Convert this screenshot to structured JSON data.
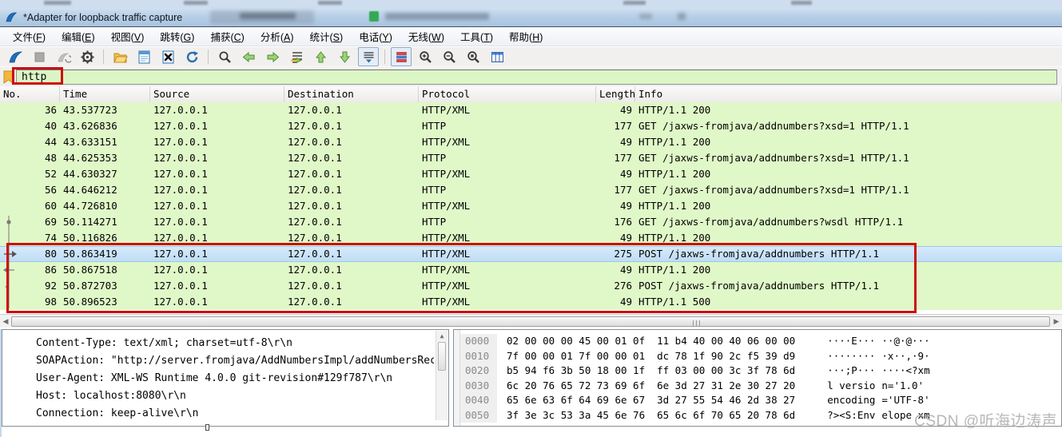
{
  "window": {
    "title": "*Adapter for loopback traffic capture"
  },
  "menu": {
    "items": [
      {
        "label": "文件",
        "accel": "F"
      },
      {
        "label": "编辑",
        "accel": "E"
      },
      {
        "label": "视图",
        "accel": "V"
      },
      {
        "label": "跳转",
        "accel": "G"
      },
      {
        "label": "捕获",
        "accel": "C"
      },
      {
        "label": "分析",
        "accel": "A"
      },
      {
        "label": "统计",
        "accel": "S"
      },
      {
        "label": "电话",
        "accel": "Y"
      },
      {
        "label": "无线",
        "accel": "W"
      },
      {
        "label": "工具",
        "accel": "T"
      },
      {
        "label": "帮助",
        "accel": "H"
      }
    ]
  },
  "toolbar": {
    "groups": [
      [
        "start-capture-icon",
        "stop-capture-icon",
        "restart-capture-icon",
        "capture-options-icon"
      ],
      [
        "open-file-icon",
        "save-file-icon",
        "close-file-icon",
        "reload-file-icon"
      ],
      [
        "find-packet-icon",
        "go-back-icon",
        "go-forward-icon",
        "go-to-packet-icon",
        "go-first-icon",
        "go-last-icon",
        "auto-scroll-icon"
      ],
      [
        "colorize-icon",
        "zoom-in-icon",
        "zoom-out-icon",
        "zoom-reset-icon",
        "resize-columns-icon"
      ]
    ],
    "toggled": [
      "auto-scroll-icon",
      "colorize-icon"
    ]
  },
  "filter": {
    "value": "http"
  },
  "packet_list": {
    "columns": [
      "No.",
      "Time",
      "Source",
      "Destination",
      "Protocol",
      "Length",
      "Info"
    ],
    "selected_no": "80",
    "rows": [
      {
        "no": "36",
        "time": "43.537723",
        "src": "127.0.0.1",
        "dst": "127.0.0.1",
        "proto": "HTTP/XML",
        "len": "49",
        "info": "HTTP/1.1 200"
      },
      {
        "no": "40",
        "time": "43.626836",
        "src": "127.0.0.1",
        "dst": "127.0.0.1",
        "proto": "HTTP",
        "len": "177",
        "info": "GET /jaxws-fromjava/addnumbers?xsd=1 HTTP/1.1"
      },
      {
        "no": "44",
        "time": "43.633151",
        "src": "127.0.0.1",
        "dst": "127.0.0.1",
        "proto": "HTTP/XML",
        "len": "49",
        "info": "HTTP/1.1 200"
      },
      {
        "no": "48",
        "time": "44.625353",
        "src": "127.0.0.1",
        "dst": "127.0.0.1",
        "proto": "HTTP",
        "len": "177",
        "info": "GET /jaxws-fromjava/addnumbers?xsd=1 HTTP/1.1"
      },
      {
        "no": "52",
        "time": "44.630327",
        "src": "127.0.0.1",
        "dst": "127.0.0.1",
        "proto": "HTTP/XML",
        "len": "49",
        "info": "HTTP/1.1 200"
      },
      {
        "no": "56",
        "time": "44.646212",
        "src": "127.0.0.1",
        "dst": "127.0.0.1",
        "proto": "HTTP",
        "len": "177",
        "info": "GET /jaxws-fromjava/addnumbers?xsd=1 HTTP/1.1"
      },
      {
        "no": "60",
        "time": "44.726810",
        "src": "127.0.0.1",
        "dst": "127.0.0.1",
        "proto": "HTTP/XML",
        "len": "49",
        "info": "HTTP/1.1 200"
      },
      {
        "no": "69",
        "time": "50.114271",
        "src": "127.0.0.1",
        "dst": "127.0.0.1",
        "proto": "HTTP",
        "len": "176",
        "info": "GET /jaxws-fromjava/addnumbers?wsdl HTTP/1.1"
      },
      {
        "no": "74",
        "time": "50.116826",
        "src": "127.0.0.1",
        "dst": "127.0.0.1",
        "proto": "HTTP/XML",
        "len": "49",
        "info": "HTTP/1.1 200"
      },
      {
        "no": "80",
        "time": "50.863419",
        "src": "127.0.0.1",
        "dst": "127.0.0.1",
        "proto": "HTTP/XML",
        "len": "275",
        "info": "POST /jaxws-fromjava/addnumbers HTTP/1.1"
      },
      {
        "no": "86",
        "time": "50.867518",
        "src": "127.0.0.1",
        "dst": "127.0.0.1",
        "proto": "HTTP/XML",
        "len": "49",
        "info": "HTTP/1.1 200"
      },
      {
        "no": "92",
        "time": "50.872703",
        "src": "127.0.0.1",
        "dst": "127.0.0.1",
        "proto": "HTTP/XML",
        "len": "276",
        "info": "POST /jaxws-fromjava/addnumbers HTTP/1.1"
      },
      {
        "no": "98",
        "time": "50.896523",
        "src": "127.0.0.1",
        "dst": "127.0.0.1",
        "proto": "HTTP/XML",
        "len": "49",
        "info": "HTTP/1.1 500"
      }
    ]
  },
  "detail_pane": {
    "lines": [
      "Content-Type: text/xml; charset=utf-8\\r\\n",
      "SOAPAction: \"http://server.fromjava/AddNumbersImpl/addNumbersRec",
      "User-Agent: XML-WS Runtime 4.0.0 git-revision#129f787\\r\\n",
      "Host: localhost:8080\\r\\n",
      "Connection: keep-alive\\r\\n"
    ]
  },
  "bytes_pane": {
    "rows": [
      {
        "offset": "0000",
        "hex1": "02 00 00 00 45 00 01 0f",
        "hex2": "11 b4 40 00 40 06 00 00",
        "ascii1": "····E···",
        "ascii2": "··@·@···"
      },
      {
        "offset": "0010",
        "hex1": "7f 00 00 01 7f 00 00 01",
        "hex2": "dc 78 1f 90 2c f5 39 d9",
        "ascii1": "········",
        "ascii2": "·x··,·9·"
      },
      {
        "offset": "0020",
        "hex1": "b5 94 f6 3b 50 18 00 1f",
        "hex2": "ff 03 00 00 3c 3f 78 6d",
        "ascii1": "···;P···",
        "ascii2": "····<?xm"
      },
      {
        "offset": "0030",
        "hex1": "6c 20 76 65 72 73 69 6f",
        "hex2": "6e 3d 27 31 2e 30 27 20",
        "ascii1": "l versio",
        "ascii2": "n='1.0'"
      },
      {
        "offset": "0040",
        "hex1": "65 6e 63 6f 64 69 6e 67",
        "hex2": "3d 27 55 54 46 2d 38 27",
        "ascii1": "encoding",
        "ascii2": "='UTF-8'"
      },
      {
        "offset": "0050",
        "hex1": "3f 3e 3c 53 3a 45 6e 76",
        "hex2": "65 6c 6f 70 65 20 78 6d",
        "ascii1": "?><S:Env",
        "ascii2": "elope xm"
      }
    ]
  },
  "watermark": "CSDN @听海边涛声",
  "colors": {
    "annotation_red": "#cd0d0d",
    "http_row_green": "#e0f8c8",
    "selected_row_blue": "#c9e2f7",
    "filter_valid_green": "#dcf5c4",
    "title_bar_blue": "#b7cfe7"
  }
}
